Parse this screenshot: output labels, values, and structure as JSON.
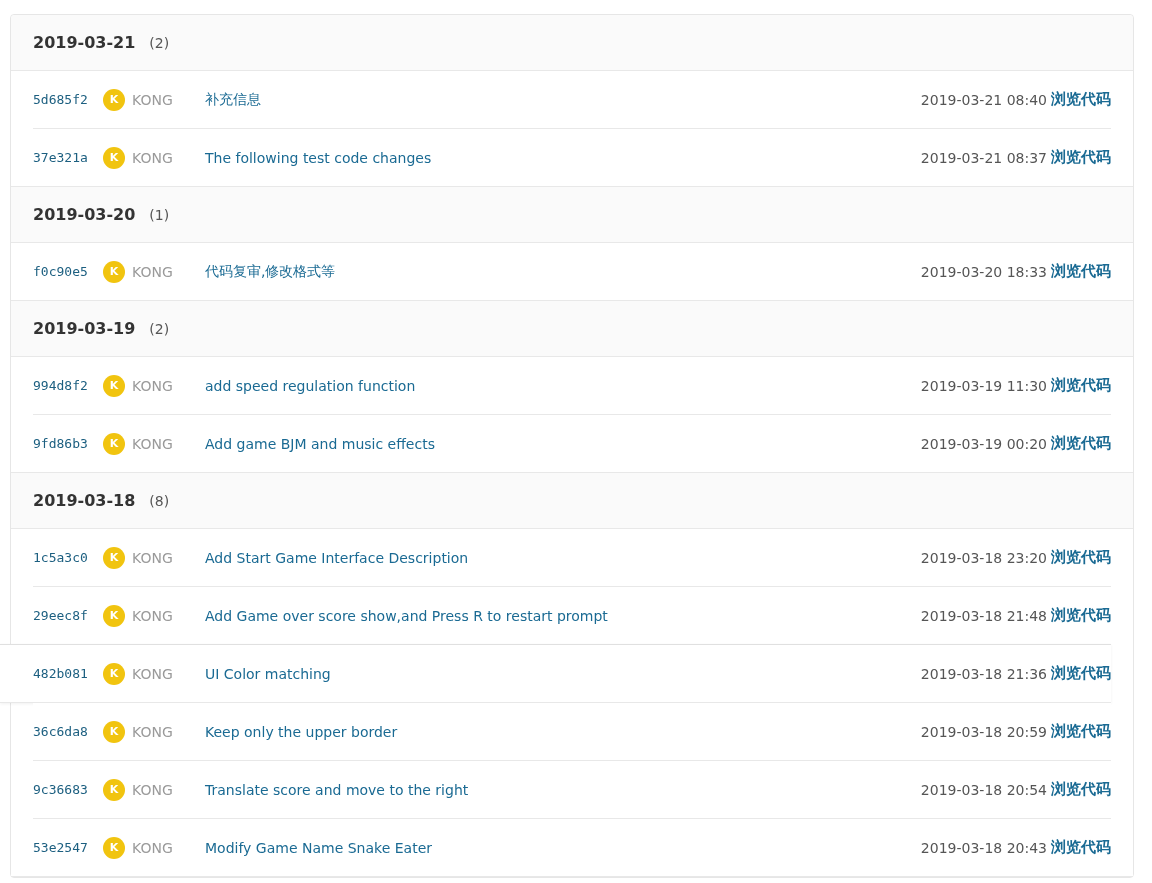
{
  "groups": [
    {
      "date": "2019-03-21",
      "count": "(2)",
      "commits": [
        {
          "hash": "5d685f2",
          "avatar": "K",
          "author": "KONG",
          "message": "补充信息",
          "time": "2019-03-21 08:40",
          "link": "浏览代码",
          "hovered": false
        },
        {
          "hash": "37e321a",
          "avatar": "K",
          "author": "KONG",
          "message": "The following test code changes",
          "time": "2019-03-21 08:37",
          "link": "浏览代码",
          "hovered": false
        }
      ]
    },
    {
      "date": "2019-03-20",
      "count": "(1)",
      "commits": [
        {
          "hash": "f0c90e5",
          "avatar": "K",
          "author": "KONG",
          "message": "代码复审,修改格式等",
          "time": "2019-03-20 18:33",
          "link": "浏览代码",
          "hovered": false
        }
      ]
    },
    {
      "date": "2019-03-19",
      "count": "(2)",
      "commits": [
        {
          "hash": "994d8f2",
          "avatar": "K",
          "author": "KONG",
          "message": "add speed regulation function",
          "time": "2019-03-19 11:30",
          "link": "浏览代码",
          "hovered": false
        },
        {
          "hash": "9fd86b3",
          "avatar": "K",
          "author": "KONG",
          "message": "Add game BJM and music effects",
          "time": "2019-03-19 00:20",
          "link": "浏览代码",
          "hovered": false
        }
      ]
    },
    {
      "date": "2019-03-18",
      "count": "(8)",
      "commits": [
        {
          "hash": "1c5a3c0",
          "avatar": "K",
          "author": "KONG",
          "message": "Add Start Game Interface Description",
          "time": "2019-03-18 23:20",
          "link": "浏览代码",
          "hovered": false
        },
        {
          "hash": "29eec8f",
          "avatar": "K",
          "author": "KONG",
          "message": "Add Game over score show,and Press R to restart prompt",
          "time": "2019-03-18 21:48",
          "link": "浏览代码",
          "hovered": false
        },
        {
          "hash": "482b081",
          "avatar": "K",
          "author": "KONG",
          "message": "UI Color matching",
          "time": "2019-03-18 21:36",
          "link": "浏览代码",
          "hovered": true
        },
        {
          "hash": "36c6da8",
          "avatar": "K",
          "author": "KONG",
          "message": "Keep only the upper border",
          "time": "2019-03-18 20:59",
          "link": "浏览代码",
          "hovered": false
        },
        {
          "hash": "9c36683",
          "avatar": "K",
          "author": "KONG",
          "message": "Translate score and move to the right",
          "time": "2019-03-18 20:54",
          "link": "浏览代码",
          "hovered": false
        },
        {
          "hash": "53e2547",
          "avatar": "K",
          "author": "KONG",
          "message": "Modify Game Name Snake Eater",
          "time": "2019-03-18 20:43",
          "link": "浏览代码",
          "hovered": false
        }
      ]
    }
  ]
}
